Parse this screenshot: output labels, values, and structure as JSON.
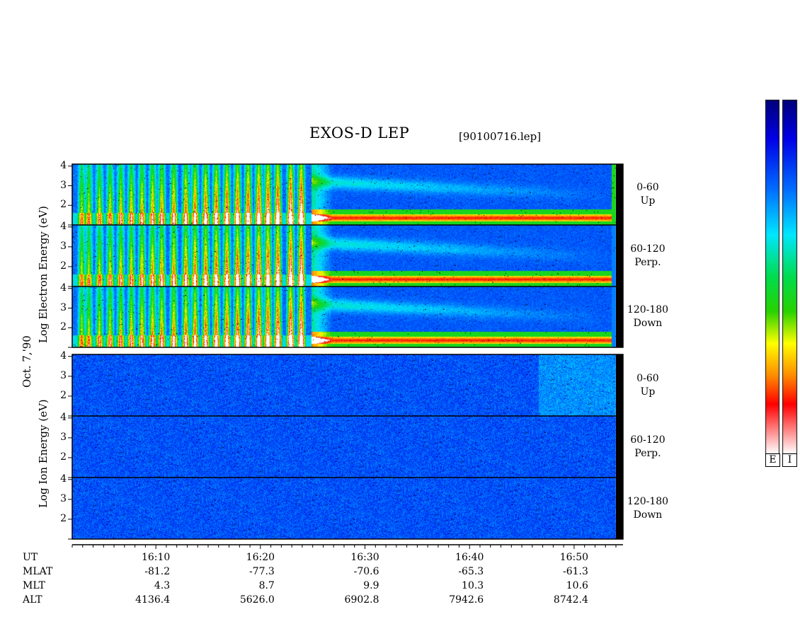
{
  "header": {
    "title": "EXOS-D LEP",
    "filename": "[90100716.lep]"
  },
  "side_label": "Oct. 7,'90",
  "groups": [
    {
      "name": "Electron",
      "ylabel": "Log Electron Energy (eV)"
    },
    {
      "name": "Ion",
      "ylabel": "Log Ion Energy (eV)"
    }
  ],
  "panels": [
    {
      "species": "electron",
      "angle": "0-60",
      "direction": "Up"
    },
    {
      "species": "electron",
      "angle": "60-120",
      "direction": "Perp."
    },
    {
      "species": "electron",
      "angle": "120-180",
      "direction": "Down"
    },
    {
      "species": "ion",
      "angle": "0-60",
      "direction": "Up"
    },
    {
      "species": "ion",
      "angle": "60-120",
      "direction": "Perp."
    },
    {
      "species": "ion",
      "angle": "120-180",
      "direction": "Down"
    }
  ],
  "y_ticks": [
    "4",
    "3",
    "2"
  ],
  "x_axis": {
    "row_labels": [
      "UT",
      "MLAT",
      "MLT",
      "ALT"
    ],
    "columns": [
      {
        "UT": "16:10",
        "MLAT": "-81.2",
        "MLT": "4.3",
        "ALT": "4136.4"
      },
      {
        "UT": "16:20",
        "MLAT": "-77.3",
        "MLT": "8.7",
        "ALT": "5626.0"
      },
      {
        "UT": "16:30",
        "MLAT": "-70.6",
        "MLT": "9.9",
        "ALT": "6902.8"
      },
      {
        "UT": "16:40",
        "MLAT": "-65.3",
        "MLT": "10.3",
        "ALT": "7942.6"
      },
      {
        "UT": "16:50",
        "MLAT": "-61.3",
        "MLT": "10.6",
        "ALT": "8742.4"
      }
    ]
  },
  "colorbars": [
    {
      "label": "E"
    },
    {
      "label": "I"
    }
  ],
  "colors": {
    "background": "#ffffff",
    "frame": "#000000",
    "low": "#0000a0",
    "high": "#ff0000"
  },
  "chart_data": {
    "type": "heatmap",
    "title": "EXOS-D LEP",
    "xlabel": "UT",
    "ylabel": "Log Energy (eV)",
    "x_range": [
      "16:02",
      "16:54"
    ],
    "x_ticks": [
      "16:10",
      "16:20",
      "16:30",
      "16:40",
      "16:50"
    ],
    "ylim": [
      1,
      4.1
    ],
    "y_scale": "log energy",
    "panels": [
      {
        "name": "Electron 0-60 Up"
      },
      {
        "name": "Electron 60-120 Perp."
      },
      {
        "name": "Electron 120-180 Down"
      },
      {
        "name": "Ion 0-60 Up"
      },
      {
        "name": "Ion 60-120 Perp."
      },
      {
        "name": "Ion 120-180 Down"
      }
    ],
    "colorscale": [
      "#0000a0",
      "#0000ff",
      "#00ffff",
      "#00ff00",
      "#ffff00",
      "#ff8000",
      "#ff0000",
      "#ffffff"
    ]
  }
}
